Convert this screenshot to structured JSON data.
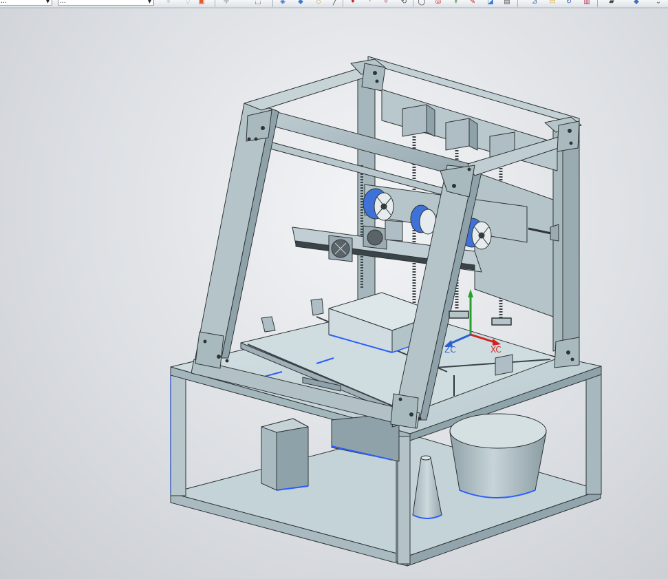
{
  "toolbar": {
    "filter_combo_value": "...",
    "assembly_combo_value": "...",
    "icons": [
      {
        "name": "snap-point-icon",
        "glyph": "⌖",
        "color": "#b0b4ba"
      },
      {
        "name": "filter-icon",
        "glyph": "▽",
        "color": "#b0b4ba"
      },
      {
        "name": "select-feature-icon",
        "glyph": "▣",
        "color": "#e05a2a"
      },
      {
        "name": "move-icon",
        "glyph": "✛",
        "color": "#8a929c"
      },
      {
        "name": "marquee-select-icon",
        "glyph": "⬚",
        "color": "#444"
      },
      {
        "name": "orient-view-icon",
        "glyph": "◈",
        "color": "#3b6fc4"
      },
      {
        "name": "shaded-view-icon",
        "glyph": "◆",
        "color": "#3b7ad8"
      },
      {
        "name": "display-style-icon",
        "glyph": "◇",
        "color": "#d4a020"
      },
      {
        "name": "line-icon",
        "glyph": "╱",
        "color": "#444"
      },
      {
        "name": "sketch-point-icon",
        "glyph": "✦",
        "color": "#c02020"
      },
      {
        "name": "arc-icon",
        "glyph": "◜",
        "color": "#444"
      },
      {
        "name": "snap-end-icon",
        "glyph": "✧",
        "color": "#c03070"
      },
      {
        "name": "rotate-icon",
        "glyph": "⟲",
        "color": "#444"
      },
      {
        "name": "circle-icon",
        "glyph": "◯",
        "color": "#333"
      },
      {
        "name": "tangent-icon",
        "glyph": "◎",
        "color": "#c02020"
      },
      {
        "name": "axis-icon",
        "glyph": "↟",
        "color": "#2a7a2a"
      },
      {
        "name": "pen-icon",
        "glyph": "✎",
        "color": "#c02020"
      },
      {
        "name": "plane-icon",
        "glyph": "◪",
        "color": "#3b7ad8"
      },
      {
        "name": "layer-icon",
        "glyph": "▤",
        "color": "#555"
      },
      {
        "name": "measure-icon",
        "glyph": "⊿",
        "color": "#3b5fb0"
      },
      {
        "name": "folder-icon",
        "glyph": "▭",
        "color": "#d4a020"
      },
      {
        "name": "refresh-icon",
        "glyph": "↻",
        "color": "#3b5fb0"
      },
      {
        "name": "chart-icon",
        "glyph": "▥",
        "color": "#b03050"
      },
      {
        "name": "box-icon",
        "glyph": "▰",
        "color": "#444"
      },
      {
        "name": "cube-icon",
        "glyph": "◆",
        "color": "#3b6fc4"
      },
      {
        "name": "more-icon",
        "glyph": "⌄",
        "color": "#444"
      }
    ]
  },
  "viewport": {
    "triad": {
      "zc_label": "ZC",
      "xc_label": "XC"
    },
    "colors": {
      "frame": "#b2c2c7",
      "frame_edge": "#2e3436",
      "table_top": "#c9d8dc",
      "highlight": "#2a5cff",
      "triad_x": "#d42020",
      "triad_z": "#2a60d0",
      "triad_y": "#28a028"
    }
  }
}
